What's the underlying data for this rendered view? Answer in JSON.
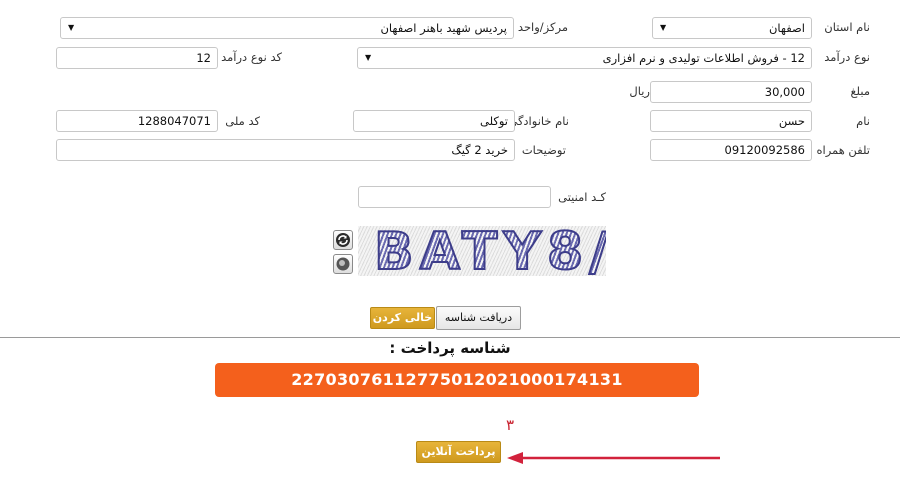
{
  "form": {
    "province": {
      "label": "نام استان",
      "value": "اصفهان"
    },
    "center": {
      "label": "مرکز/واحد",
      "value": "پردیس شهید باهنر اصفهان"
    },
    "income_type": {
      "label": "نوع درآمد",
      "value": "12 - فروش اطلاعات تولیدی و نرم افزاری"
    },
    "income_code": {
      "label": "کد نوع درآمد",
      "value": "12"
    },
    "amount": {
      "label": "مبلغ",
      "value": "30,000",
      "unit": "ریال"
    },
    "first_name": {
      "label": "نام",
      "value": "حسن"
    },
    "last_name": {
      "label": "نام خانوادگی",
      "value": "توکلی"
    },
    "national_code": {
      "label": "کد ملی",
      "value": "1288047071"
    },
    "mobile": {
      "label": "تلفن همراه",
      "value": "09120092586"
    },
    "description": {
      "label": "توضیحات",
      "value": "خرید 2 گیگ"
    },
    "security_code": {
      "label": "کـد امنیتی",
      "value": ""
    },
    "captcha_text": "BATY8/"
  },
  "buttons": {
    "get_id": "دریافت شناسه",
    "clear_form": "خالی کردن فرم",
    "pay_online": "پرداخت آنلاین"
  },
  "payment": {
    "title": "شناسه پرداخت :",
    "id": "22703076112775012021000174131"
  },
  "annotation": {
    "number": "۳",
    "color": "#c8202e"
  },
  "icons": {
    "refresh": "refresh-icon",
    "audio": "audio-icon",
    "dropdown": "chevron-down-icon"
  },
  "colors": {
    "accent": "#f4601c",
    "gold_button": "#d9a42a"
  }
}
